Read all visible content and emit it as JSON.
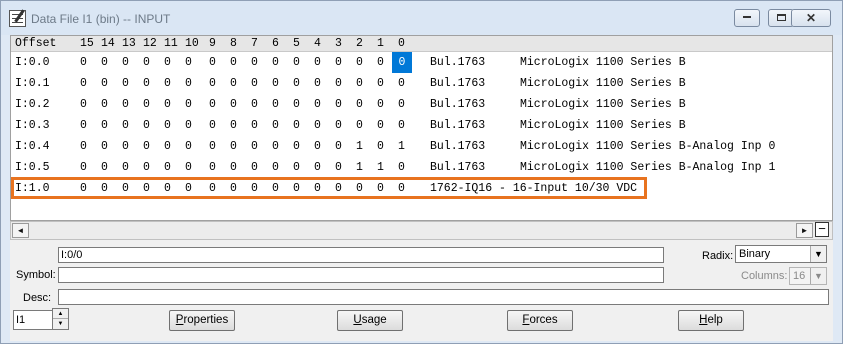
{
  "window": {
    "title": "Data File I1 (bin)  --  INPUT",
    "controls": {
      "minimize": "minimize",
      "maximize": "maximize",
      "close": "close"
    }
  },
  "grid": {
    "header": {
      "offset": "Offset",
      "bits": [
        "15",
        "14",
        "13",
        "12",
        "11",
        "10",
        "9",
        "8",
        "7",
        "6",
        "5",
        "4",
        "3",
        "2",
        "1",
        "0"
      ]
    },
    "rows": [
      {
        "offset": "I:0.0",
        "bits": [
          "0",
          "0",
          "0",
          "0",
          "0",
          "0",
          "0",
          "0",
          "0",
          "0",
          "0",
          "0",
          "0",
          "0",
          "0",
          "0"
        ],
        "module": "Bul.1763",
        "description": "MicroLogix 1100 Series B"
      },
      {
        "offset": "I:0.1",
        "bits": [
          "0",
          "0",
          "0",
          "0",
          "0",
          "0",
          "0",
          "0",
          "0",
          "0",
          "0",
          "0",
          "0",
          "0",
          "0",
          "0"
        ],
        "module": "Bul.1763",
        "description": "MicroLogix 1100 Series B"
      },
      {
        "offset": "I:0.2",
        "bits": [
          "0",
          "0",
          "0",
          "0",
          "0",
          "0",
          "0",
          "0",
          "0",
          "0",
          "0",
          "0",
          "0",
          "0",
          "0",
          "0"
        ],
        "module": "Bul.1763",
        "description": "MicroLogix 1100 Series B"
      },
      {
        "offset": "I:0.3",
        "bits": [
          "0",
          "0",
          "0",
          "0",
          "0",
          "0",
          "0",
          "0",
          "0",
          "0",
          "0",
          "0",
          "0",
          "0",
          "0",
          "0"
        ],
        "module": "Bul.1763",
        "description": "MicroLogix 1100 Series B"
      },
      {
        "offset": "I:0.4",
        "bits": [
          "0",
          "0",
          "0",
          "0",
          "0",
          "0",
          "0",
          "0",
          "0",
          "0",
          "0",
          "0",
          "0",
          "1",
          "0",
          "1"
        ],
        "module": "Bul.1763",
        "description": "MicroLogix 1100 Series B-Analog Inp 0"
      },
      {
        "offset": "I:0.5",
        "bits": [
          "0",
          "0",
          "0",
          "0",
          "0",
          "0",
          "0",
          "0",
          "0",
          "0",
          "0",
          "0",
          "0",
          "1",
          "1",
          "0"
        ],
        "module": "Bul.1763",
        "description": "MicroLogix 1100 Series B-Analog Inp 1"
      },
      {
        "offset": "I:1.0",
        "bits": [
          "0",
          "0",
          "0",
          "0",
          "0",
          "0",
          "0",
          "0",
          "0",
          "0",
          "0",
          "0",
          "0",
          "0",
          "0",
          "0"
        ],
        "module": "1762-IQ16 - 16-Input 10/30 VDC",
        "description": ""
      }
    ],
    "highlight_color": "#e8731f",
    "selection_color": "#0078d7"
  },
  "scroll": {
    "left": "◄",
    "right": "►",
    "collapse": "−"
  },
  "address": {
    "value": "I:0/0"
  },
  "symbol": {
    "label": "Symbol:",
    "value": ""
  },
  "desc": {
    "label": "Desc:",
    "value": ""
  },
  "radix": {
    "label": "Radix:",
    "value": "Binary"
  },
  "columns": {
    "label": "Columns:",
    "value": "16"
  },
  "file": {
    "value": "I1"
  },
  "buttons": {
    "properties": {
      "accel": "P",
      "rest": "roperties"
    },
    "usage": {
      "accel": "U",
      "rest": "sage"
    },
    "forces": {
      "accel": "F",
      "rest": "orces"
    },
    "help": {
      "accel": "H",
      "rest": "elp"
    }
  }
}
